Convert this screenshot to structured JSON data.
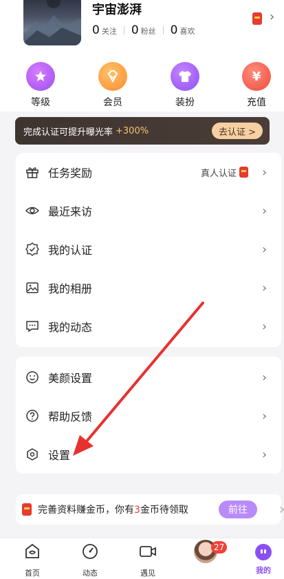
{
  "profile": {
    "username": "宇宙澎湃",
    "stats": [
      {
        "num": "0",
        "label": "关注"
      },
      {
        "num": "0",
        "label": "粉丝"
      },
      {
        "num": "0",
        "label": "喜欢"
      }
    ]
  },
  "features": [
    {
      "label": "等级",
      "icon": "star-icon"
    },
    {
      "label": "会员",
      "icon": "diamond-icon"
    },
    {
      "label": "装扮",
      "icon": "shirt-icon"
    },
    {
      "label": "充值",
      "icon": "yuan-icon",
      "glyph": "¥"
    }
  ],
  "banner": {
    "text": "完成认证可提升曝光率",
    "pct": "+300%",
    "button": "去认证 >"
  },
  "menu1": [
    {
      "label": "任务奖励",
      "extra": "真人认证"
    },
    {
      "label": "最近来访"
    },
    {
      "label": "我的认证"
    },
    {
      "label": "我的相册"
    },
    {
      "label": "我的动态"
    }
  ],
  "menu2": [
    {
      "label": "美颜设置"
    },
    {
      "label": "帮助反馈"
    },
    {
      "label": "设置"
    }
  ],
  "coins": {
    "pre": "完善资料赚金币，你有",
    "num": "3",
    "post": "金币待领取",
    "button": "前往",
    "close": "✕"
  },
  "tabbar": [
    {
      "label": "首页"
    },
    {
      "label": "动态"
    },
    {
      "label": "遇见"
    },
    {
      "label": "",
      "badge": "27"
    },
    {
      "label": "我的"
    }
  ],
  "chevron": "›",
  "colors": {
    "accent": "#8b4ff4",
    "annotation": "#e8302f"
  }
}
